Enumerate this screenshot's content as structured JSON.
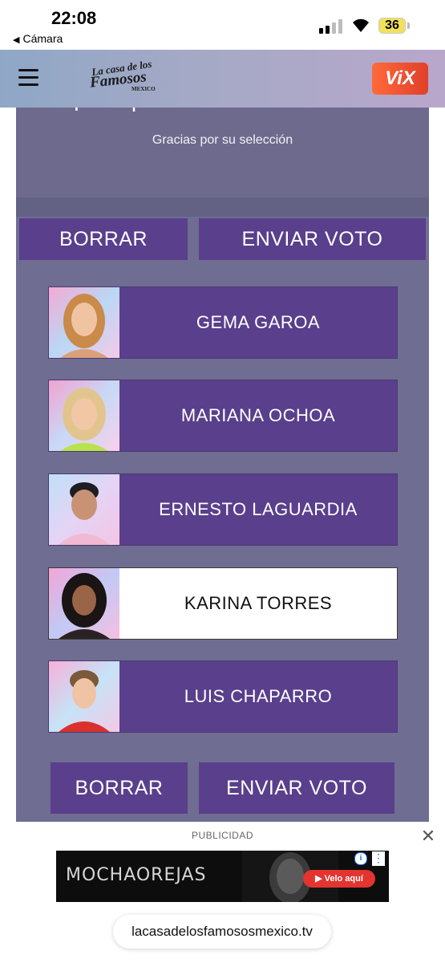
{
  "status_bar": {
    "time": "22:08",
    "back_app": "Cámara",
    "battery": "36"
  },
  "header": {
    "logo_text": [
      "La casa de los",
      "Famosos",
      "MEXICO"
    ],
    "app_badge": "ViX"
  },
  "vote": {
    "headline": "¡Vota para salvar a tu favorito!",
    "thanks": "Gracias por su selección",
    "clear_label": "BORRAR",
    "submit_label": "ENVIAR VOTO",
    "candidates": [
      {
        "name": "GEMA GAROA",
        "selected": false
      },
      {
        "name": "MARIANA OCHOA",
        "selected": false
      },
      {
        "name": "ERNESTO LAGUARDIA",
        "selected": false
      },
      {
        "name": "KARINA TORRES",
        "selected": true
      },
      {
        "name": "LUIS CHAPARRO",
        "selected": false
      }
    ]
  },
  "ad": {
    "label": "PUBLICIDAD",
    "banner_title": "MOCHAOREJAS",
    "cta": "▶ Velo aquí",
    "info_icon": "info-icon",
    "close_icon": "close-icon"
  },
  "browser": {
    "url": "lacasadelosfamososmexico.tv"
  },
  "colors": {
    "purple": "#5a3f8c",
    "panel": "#6f6d91",
    "header_gradient_start": "#8fa7c6",
    "header_gradient_end": "#b9a7cb"
  }
}
